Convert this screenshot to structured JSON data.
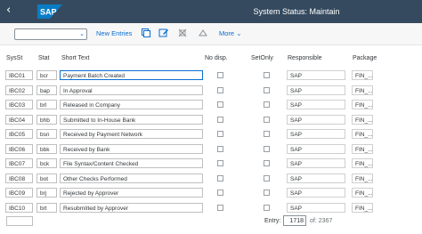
{
  "shell": {
    "title": "System Status: Maintain",
    "logo": "SAP"
  },
  "toolbar": {
    "new_entries": "New Entries",
    "more": "More",
    "tcode_value": ""
  },
  "table": {
    "headers": {
      "sysst": "SysSt",
      "stat": "Stat",
      "short_text": "Short Text",
      "no_disp": "No disp.",
      "setonly": "SetOnly",
      "responsible": "Responsible",
      "package": "Package"
    },
    "rows": [
      {
        "sysst": "IBC01",
        "stat": "bcr",
        "short_text": "Payment Batch Created",
        "responsible": "SAP",
        "package": "FIN_..."
      },
      {
        "sysst": "IBC02",
        "stat": "bap",
        "short_text": "In Approval",
        "responsible": "SAP",
        "package": "FIN_..."
      },
      {
        "sysst": "IBC03",
        "stat": "brl",
        "short_text": "Released in Company",
        "responsible": "SAP",
        "package": "FIN_..."
      },
      {
        "sysst": "IBC04",
        "stat": "bhb",
        "short_text": "Submitted to In-House Bank",
        "responsible": "SAP",
        "package": "FIN_..."
      },
      {
        "sysst": "IBC05",
        "stat": "bsn",
        "short_text": "Received by Payment Network",
        "responsible": "SAP",
        "package": "FIN_..."
      },
      {
        "sysst": "IBC06",
        "stat": "bbk",
        "short_text": "Received by Bank",
        "responsible": "SAP",
        "package": "FIN_..."
      },
      {
        "sysst": "IBC07",
        "stat": "bck",
        "short_text": "File Syntax/Content Checked",
        "responsible": "SAP",
        "package": "FIN_..."
      },
      {
        "sysst": "IBC08",
        "stat": "bot",
        "short_text": "Other Checks Performed",
        "responsible": "SAP",
        "package": "FIN_..."
      },
      {
        "sysst": "IBC09",
        "stat": "brj",
        "short_text": "Rejected by Approver",
        "responsible": "SAP",
        "package": "FIN_..."
      },
      {
        "sysst": "IBC10",
        "stat": "brt",
        "short_text": "Resubmitted by Approver",
        "responsible": "SAP",
        "package": "FIN_..."
      }
    ]
  },
  "footer": {
    "entry_label": "Entry:",
    "entry_value": "1718",
    "entry_of": "of: 2367"
  },
  "colors": {
    "shell": "#354a5f",
    "accent": "#0a6ed1"
  }
}
